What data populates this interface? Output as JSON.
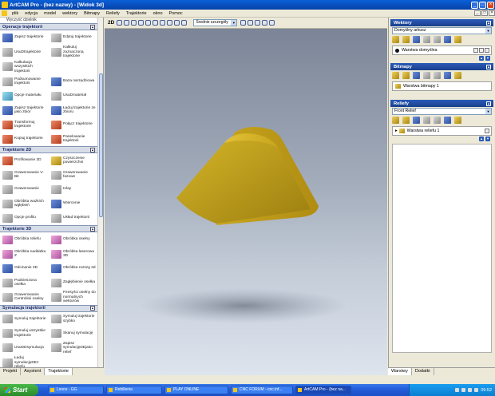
{
  "window": {
    "title": "ArtCAM Pro - (bez nazwy) - [Widok 3d]"
  },
  "window_buttons": {
    "minimize": "_",
    "maximize": "□",
    "close": "×"
  },
  "menu": [
    "plik",
    "edycja",
    "model",
    "wektory",
    "Bitmapy",
    "Reliefy",
    "Trajektorie",
    "okno",
    "Pomoc"
  ],
  "left_panel": {
    "stub_label": "Wyczyść dzielnik",
    "sections": [
      {
        "title": "Operacje trajektorii",
        "tools": [
          {
            "label": "Zapisz trajektorie",
            "color": "blue"
          },
          {
            "label": "Edytuj trajektorie",
            "color": "gray"
          },
          {
            "label": "UsuDtrajektorie",
            "color": "gray"
          },
          {
            "label": "Kalkuluj zaznaczoną trajektorie",
            "color": "gray"
          },
          {
            "label": "Kalkulacja wszystkich trajektorii",
            "color": "gray"
          },
          {
            "label": "",
            "color": "none"
          },
          {
            "label": "Podsumowanie trajektorii",
            "color": "gray"
          },
          {
            "label": "Baza narzędziowa",
            "color": "blue"
          },
          {
            "label": "Opcje materiału",
            "color": "cyan"
          },
          {
            "label": "UsuDmateriał",
            "color": "gray"
          },
          {
            "label": "Zapisz trajektorie jako zbiór",
            "color": "blue"
          },
          {
            "label": "Ładuj trajektorie ze zbioru",
            "color": "blue"
          },
          {
            "label": "Transformuj trajektorie",
            "color": "red"
          },
          {
            "label": "Połącz trajektorie",
            "color": "red"
          },
          {
            "label": "Kopiuj trajektorie",
            "color": "red"
          },
          {
            "label": "Panelowanie trajektorii",
            "color": "red"
          }
        ]
      },
      {
        "title": "Trajektorie 2D",
        "tools": [
          {
            "label": "Profilowanie 2D",
            "color": "red"
          },
          {
            "label": "Czyszczenie powierzchni",
            "color": "gold"
          },
          {
            "label": "Grawerowanie V-Bit",
            "color": "gray"
          },
          {
            "label": "Grawerowanie fazowe",
            "color": "gray"
          },
          {
            "label": "Grawerowanie",
            "color": "gray"
          },
          {
            "label": "Inlay",
            "color": "gray"
          },
          {
            "label": "Obróbka ważkich wgłębień",
            "color": "gray"
          },
          {
            "label": "Wiercenie",
            "color": "blue"
          },
          {
            "label": "Opcje profilu",
            "color": "gray"
          },
          {
            "label": "Układ trajektorii",
            "color": "gray"
          }
        ]
      },
      {
        "title": "Trajektorie 3D",
        "tools": [
          {
            "label": "Obróbka reliefu",
            "color": "pink"
          },
          {
            "label": "Obróbka osełny",
            "color": "pink"
          },
          {
            "label": "Obróbka naddatku Z",
            "color": "pink"
          },
          {
            "label": "Obróbka laserowa 3D",
            "color": "pink"
          },
          {
            "label": "Odcinanie 3D",
            "color": "blue"
          },
          {
            "label": "Obróbka rozszg 3d",
            "color": "blue"
          },
          {
            "label": "Podnieszona osełka",
            "color": "gray"
          },
          {
            "label": "Zagłębienie osełka",
            "color": "gray"
          },
          {
            "label": "Grawerowanie Centrolinii osełny",
            "color": "gray"
          },
          {
            "label": "Pzesyści osełny do normalnych wektorów",
            "color": "gray"
          }
        ]
      },
      {
        "title": "Symulacja trajektorii",
        "tools": [
          {
            "label": "Symuluj trajektorie",
            "color": "gray"
          },
          {
            "label": "Symuluj trajektorie szybko",
            "color": "gray"
          },
          {
            "label": "Symuluj wszystkie trajektorie",
            "color": "gray"
          },
          {
            "label": "Skanuj symulację",
            "color": "gray"
          },
          {
            "label": "UsuDDsymulacja",
            "color": "gray"
          },
          {
            "label": "Zapisz symulacjęDEjako relief",
            "color": "gray"
          },
          {
            "label": "Ładuj symulacjęDEz reliefu",
            "color": "gray"
          },
          {
            "label": "",
            "color": "none"
          }
        ]
      }
    ],
    "tabs": [
      "Projekt",
      "Asystent",
      "Trajektorie"
    ],
    "active_tab": "Trajektorie"
  },
  "view_toolbar": {
    "mode_label": "2D",
    "quality_select": "Średnie szczegóły"
  },
  "right_panel": {
    "vectors": {
      "title": "Wektory",
      "combo": "Domyślny arkusz",
      "layer": "Warstwa domyślna"
    },
    "bitmaps": {
      "title": "Bitmapy",
      "layer": "Warstwa bitmapy 1"
    },
    "reliefs": {
      "title": "Reliefy",
      "combo": "Front Relief",
      "layer": "Warstwa reliefu 1"
    },
    "tabs": [
      "Warstwy",
      "Dodatki"
    ],
    "active_tab": "Warstwy"
  },
  "taskbar": {
    "start": "Start",
    "tasks": [
      {
        "label": "Lsoos - GG",
        "active": false
      },
      {
        "label": "Rebillenia",
        "active": false
      },
      {
        "label": "PLAY ONLINE",
        "active": false
      },
      {
        "label": "CNC FORUM - cnc.inf...",
        "active": false
      },
      {
        "label": "ArtCAM Pro - (bez na...",
        "active": true
      }
    ],
    "clock": "09:52"
  },
  "colors": {
    "model": "#c8a21c",
    "title_bar": "#0a5fd8",
    "panel_header": "#2a5ab8"
  }
}
